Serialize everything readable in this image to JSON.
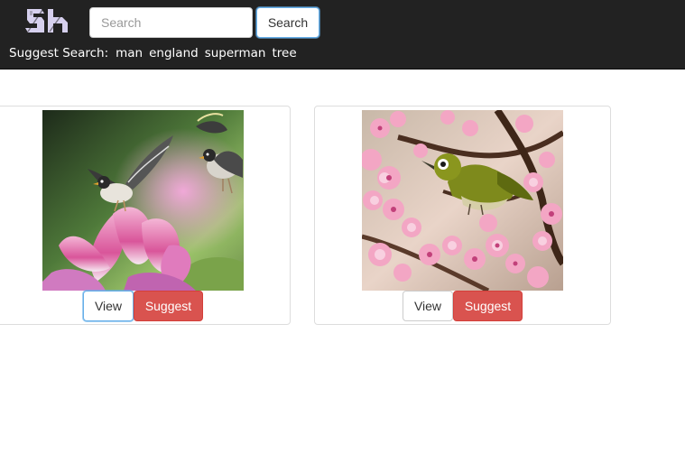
{
  "navbar": {
    "logo_text": "Sh",
    "search": {
      "placeholder": "Search",
      "value": "",
      "button_label": "Search"
    },
    "suggest": {
      "label": "Suggest Search:",
      "terms": [
        "man",
        "england",
        "superman",
        "tree"
      ]
    }
  },
  "cards": [
    {
      "image_icon": "birds-lotus-photo",
      "view_label": "View",
      "suggest_label": "Suggest"
    },
    {
      "image_icon": "bird-blossom-photo",
      "view_label": "View",
      "suggest_label": "Suggest"
    }
  ],
  "colors": {
    "navbar_bg": "#222222",
    "suggest_button": "#d9534f",
    "focus_ring": "#66afe9",
    "logo": "#d6d0ee"
  }
}
